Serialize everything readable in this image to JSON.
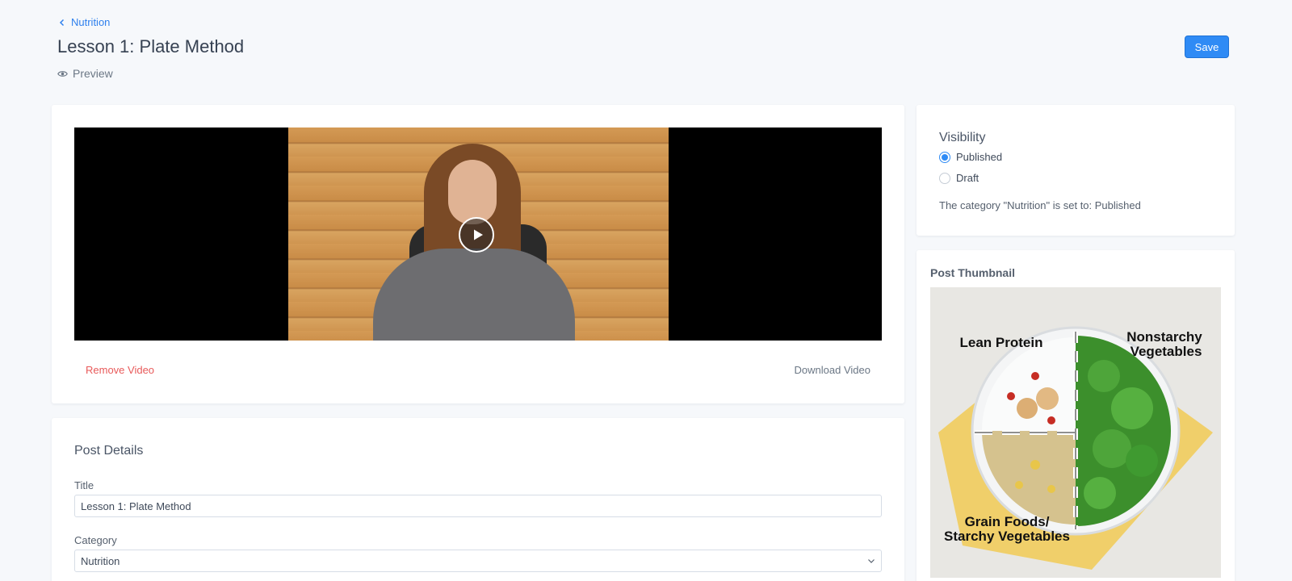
{
  "breadcrumb": {
    "label": "Nutrition"
  },
  "header": {
    "title": "Lesson 1: Plate Method",
    "preview_label": "Preview",
    "save_label": "Save"
  },
  "video": {
    "remove_label": "Remove Video",
    "download_label": "Download Video"
  },
  "post_details": {
    "heading": "Post Details",
    "title_label": "Title",
    "title_value": "Lesson 1: Plate Method",
    "category_label": "Category",
    "category_value": "Nutrition"
  },
  "visibility": {
    "heading": "Visibility",
    "options": [
      {
        "label": "Published",
        "checked": true
      },
      {
        "label": "Draft",
        "checked": false
      }
    ],
    "status_text": "The category \"Nutrition\" is set to: Published"
  },
  "thumbnail": {
    "heading": "Post Thumbnail",
    "labels": {
      "lean_protein": "Lean Protein",
      "nonstarchy_1": "Nonstarchy",
      "nonstarchy_2": "Vegetables",
      "grain_1": "Grain Foods/",
      "grain_2": "Starchy Vegetables"
    }
  },
  "colors": {
    "accent": "#2f8bf5",
    "danger": "#e85a5a",
    "link": "#2f80ed"
  }
}
